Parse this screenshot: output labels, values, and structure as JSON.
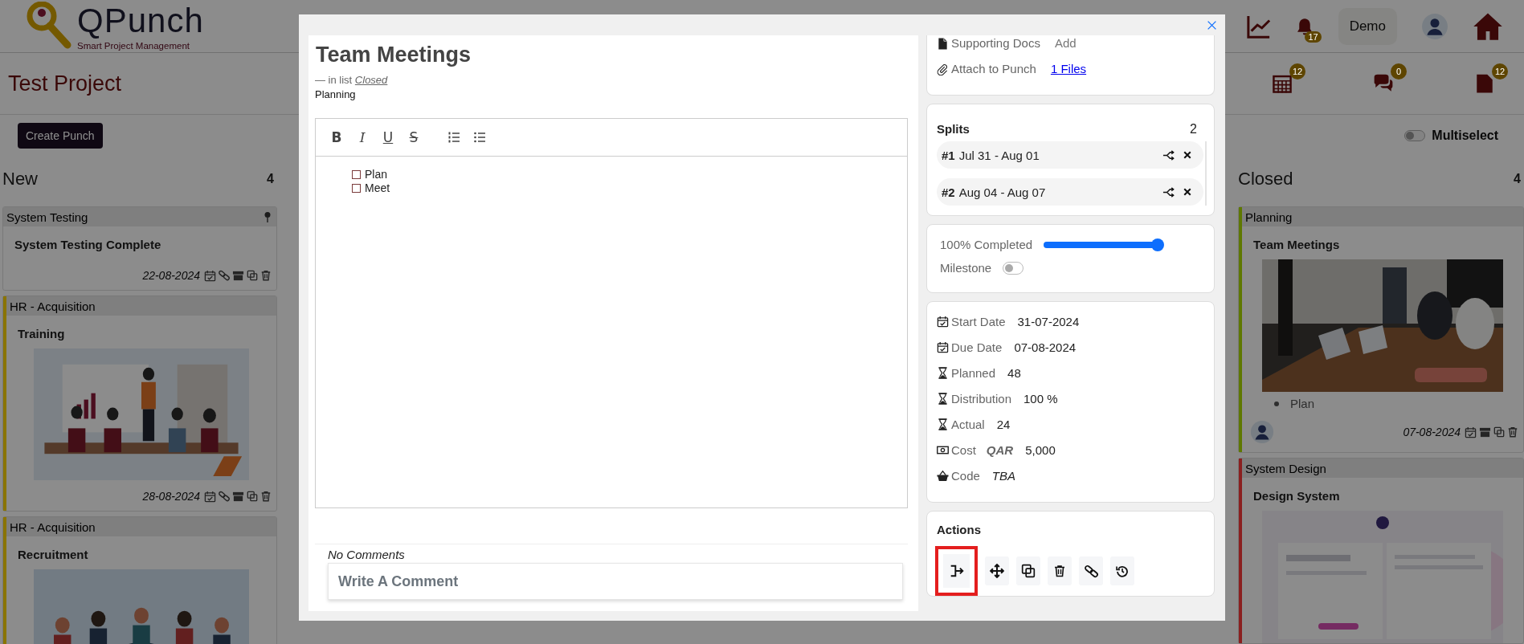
{
  "header": {
    "logo": {
      "title": "QPunch",
      "subtitle": "Smart Project Management"
    },
    "notifications": "17",
    "user": "Demo"
  },
  "project": {
    "title": "Test Project",
    "counters": [
      {
        "kind": "calendar",
        "count": "12"
      },
      {
        "kind": "chat",
        "count": "0"
      },
      {
        "kind": "document",
        "count": "12"
      }
    ]
  },
  "toolbar": {
    "create_button": "Create Punch",
    "multiselect": {
      "label": "Multiselect",
      "on": false
    }
  },
  "columns": [
    {
      "title": "New",
      "count": "4",
      "cards": [
        {
          "group": "System Testing",
          "title": "System Testing Complete",
          "date": "22-08-2024",
          "pinned": true,
          "linked": true
        },
        {
          "group": "HR - Acquisition",
          "title": "Training",
          "color": "#8a7400",
          "image": {
            "kind": "picture"
          },
          "date": "28-08-2024",
          "pinned": false,
          "linked": true
        },
        {
          "group": "HR - Acquisition",
          "title": "Recruitment",
          "color": "#8a7400",
          "image": {
            "kind": "picture"
          }
        }
      ]
    },
    {
      "title": "Closed",
      "count": "4",
      "cards": [
        {
          "group": "Planning",
          "title": "Team Meetings",
          "color": "#5e7800",
          "image": {
            "kind": "picture"
          },
          "bullets": [
            "Plan"
          ],
          "assignee": true,
          "date": "07-08-2024",
          "pinned": false,
          "linked": false
        },
        {
          "group": "System Design",
          "title": "Design System",
          "color": "#8a1f1f",
          "image": {
            "kind": "picture"
          }
        }
      ]
    }
  ],
  "modal": {
    "title": "Team Meetings",
    "list_label": "— in list",
    "list_name": "Closed",
    "group": "Planning",
    "editor": {
      "toolbar": [
        {
          "kind": "bold",
          "label": "B"
        },
        {
          "kind": "italic",
          "label": "I"
        },
        {
          "kind": "underline",
          "label": "U"
        },
        {
          "kind": "strike",
          "label": "S"
        },
        {
          "kind": "ordered-list"
        },
        {
          "kind": "bullet-list"
        }
      ],
      "items": [
        {
          "text": "Plan",
          "checked": false
        },
        {
          "text": "Meet",
          "checked": false
        }
      ]
    },
    "comments": {
      "status": "No Comments",
      "placeholder": "Write A Comment"
    },
    "attachments": [
      {
        "kind": "docs",
        "label": "Supporting Docs",
        "action": "Add"
      },
      {
        "kind": "attach",
        "label": "Attach to Punch",
        "action": "1 Files"
      }
    ],
    "splits": {
      "title": "Splits",
      "count": "2",
      "items": [
        {
          "number": "#1",
          "range": "Jul 31 - Aug 01"
        },
        {
          "number": "#2",
          "range": "Aug 04 - Aug 07"
        }
      ]
    },
    "progress": {
      "label": "100% Completed",
      "level": 1
    },
    "milestone": {
      "label": "Milestone",
      "on": false
    },
    "details": [
      {
        "kind": "date",
        "label": "Start Date",
        "value": "31-07-2024"
      },
      {
        "kind": "date",
        "label": "Due Date",
        "value": "07-08-2024"
      },
      {
        "kind": "hours",
        "label": "Planned",
        "value": "48"
      },
      {
        "kind": "hours",
        "label": "Distribution",
        "value": "100 %"
      },
      {
        "kind": "hours",
        "label": "Actual",
        "value": "24"
      },
      {
        "kind": "cost",
        "label": "Cost",
        "currency": "QAR",
        "value": "5,000"
      },
      {
        "kind": "code",
        "label": "Code",
        "value": "TBA"
      }
    ],
    "actions": {
      "title": "Actions",
      "buttons": [
        {
          "kind": "merge",
          "selected": true
        },
        {
          "kind": "move",
          "selected": false
        },
        {
          "kind": "copy",
          "selected": false
        },
        {
          "kind": "delete",
          "selected": false
        },
        {
          "kind": "link",
          "selected": false
        },
        {
          "kind": "history",
          "selected": false
        }
      ]
    }
  }
}
